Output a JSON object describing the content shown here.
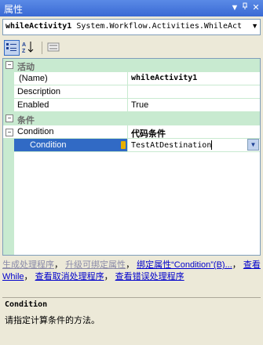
{
  "window": {
    "title": "属性",
    "pin_icon": "pin-icon",
    "close_icon": "close-icon"
  },
  "object_selector": {
    "name": "whileActivity1",
    "type": " System.Workflow.Activities.WhileAct"
  },
  "toolbar": {
    "categorized": "categorized-icon",
    "alphabetical": "alphabetical-icon",
    "property_pages": "property-pages-icon"
  },
  "grid": {
    "categories": [
      {
        "label": "活动",
        "rows": [
          {
            "name": "(Name)",
            "value": "whileActivity1"
          },
          {
            "name": "Description",
            "value": ""
          },
          {
            "name": "Enabled",
            "value": "True"
          }
        ]
      },
      {
        "label": "条件",
        "rows": [
          {
            "name": "Condition",
            "value": "代码条件"
          },
          {
            "name": "Condition",
            "value": "TestAtDestination"
          }
        ]
      }
    ]
  },
  "commands": {
    "gen_handlers": "生成处理程序",
    "comma1": "，",
    "promote": "升级可绑定属性",
    "comma2": "，",
    "bind_prop": "绑定属性“Condition”(B)...",
    "comma3": "，",
    "view_while": "查看 While",
    "comma4": "，",
    "view_cancel": "查看取消处理程序",
    "comma5": "，",
    "view_fault": "查看错误处理程序"
  },
  "description": {
    "title": "Condition",
    "text": "请指定计算条件的方法。"
  },
  "colors": {
    "category_bg": "#c8ead0",
    "selection": "#316ac5",
    "link": "#0000cc",
    "titlebar": "#3a6ad4"
  }
}
